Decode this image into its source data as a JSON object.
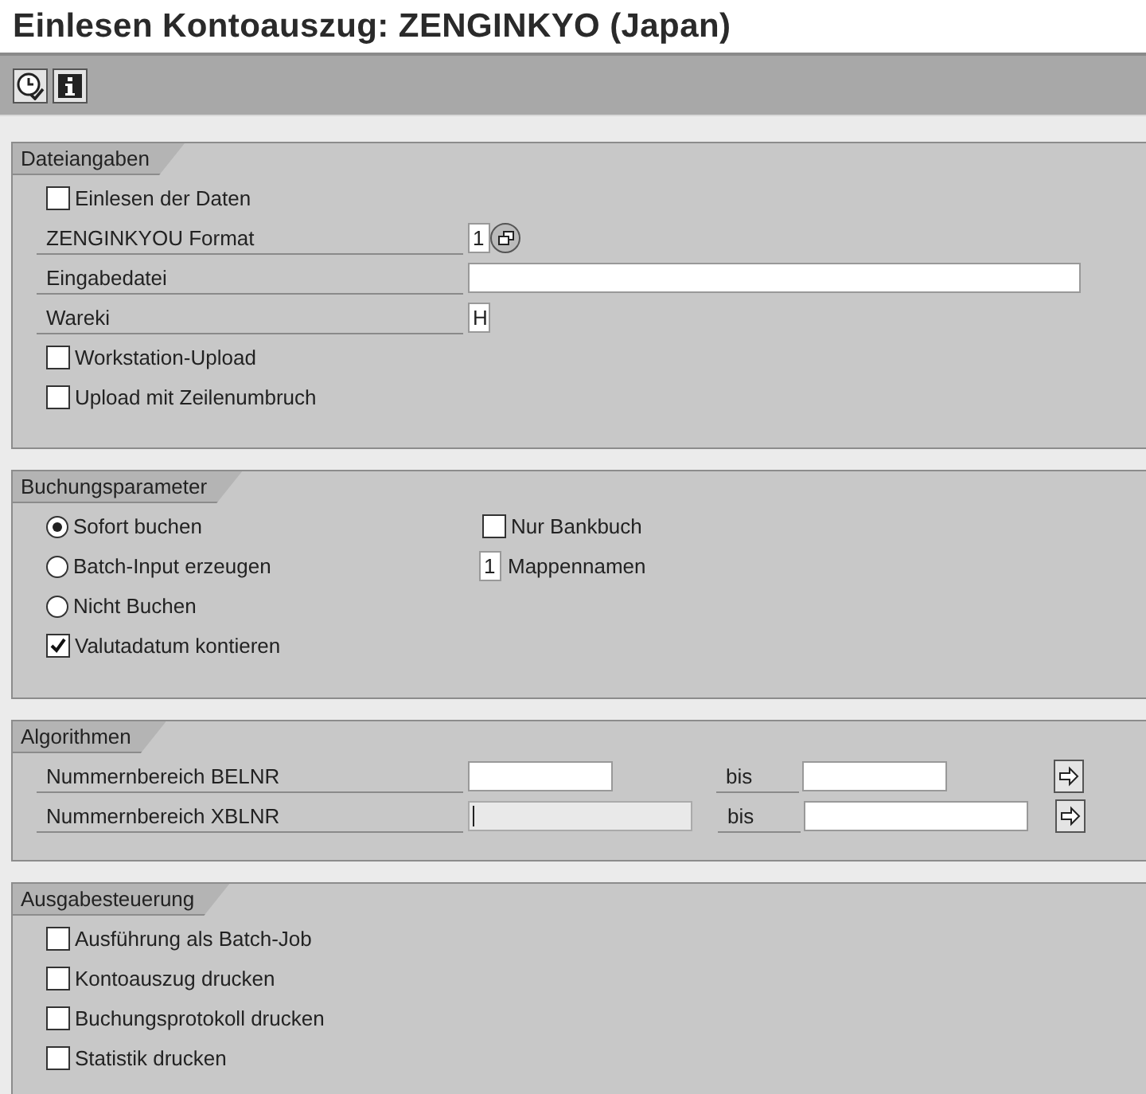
{
  "window": {
    "title": "Einlesen Kontoauszug: ZENGINKYO (Japan)"
  },
  "toolbar": [
    {
      "kind": "execute"
    },
    {
      "kind": "info"
    }
  ],
  "sections": [
    {
      "title": "Dateiangaben",
      "rows": [
        {
          "kind": "checkbox",
          "label": "Einlesen der Daten",
          "checked": false
        },
        {
          "kind": "select",
          "label": "ZENGINKYOU Format",
          "value": "1"
        },
        {
          "kind": "field",
          "label": "Eingabedatei"
        },
        {
          "kind": "field",
          "label": "Wareki",
          "value": "H"
        },
        {
          "kind": "checkbox",
          "label": "Workstation-Upload",
          "checked": false
        },
        {
          "kind": "checkbox",
          "label": "Upload mit Zeilenumbruch",
          "checked": false
        }
      ]
    },
    {
      "title": "Buchungsparameter",
      "columns": [
        [
          {
            "kind": "radio",
            "label": "Sofort buchen",
            "selected": true
          },
          {
            "kind": "radio",
            "label": "Batch-Input erzeugen",
            "selected": false
          },
          {
            "kind": "radio",
            "label": "Nicht Buchen",
            "selected": false
          },
          {
            "kind": "checkbox",
            "label": "Valutadatum kontieren",
            "checked": true
          }
        ],
        [
          {
            "kind": "checkbox",
            "label": "Nur Bankbuch",
            "checked": false
          },
          {
            "kind": "inline-field",
            "value": "1",
            "label": "Mappennamen"
          }
        ]
      ]
    },
    {
      "title": "Algorithmen",
      "rows": [
        {
          "kind": "range",
          "label": "Nummernbereich BELNR",
          "to_label": "bis",
          "focused": false
        },
        {
          "kind": "range",
          "label": "Nummernbereich XBLNR",
          "to_label": "bis",
          "focused": true
        }
      ]
    },
    {
      "title": "Ausgabesteuerung",
      "rows": [
        {
          "kind": "checkbox",
          "label": "Ausführung als Batch-Job",
          "checked": false
        },
        {
          "kind": "checkbox",
          "label": "Kontoauszug drucken",
          "checked": false
        },
        {
          "kind": "checkbox",
          "label": "Buchungsprotokoll drucken",
          "checked": false
        },
        {
          "kind": "checkbox",
          "label": "Statistik drucken",
          "checked": false
        }
      ]
    }
  ]
}
